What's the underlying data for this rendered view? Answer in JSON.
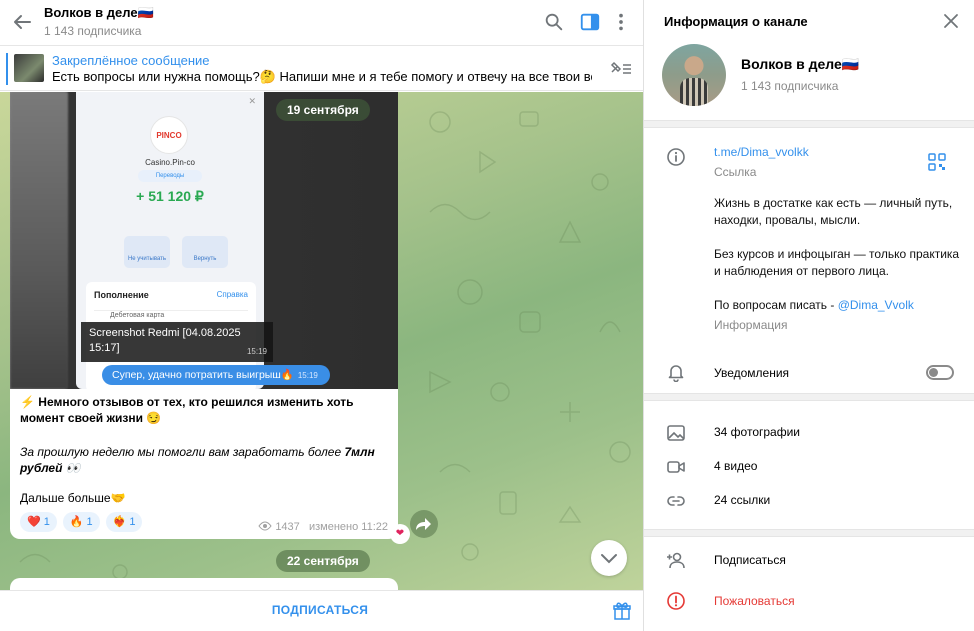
{
  "chat": {
    "title": "Волков в деле🇷🇺",
    "subscribers": "1 143 подписчика",
    "pinned": {
      "title": "Закреплённое сообщение",
      "text": "Есть вопросы или нужна помощь?🤔  Напиши мне и я тебе помогу и отвечу на все твои воп..."
    },
    "dates": [
      "19 сентября",
      "22 сентября"
    ],
    "screenshot": {
      "app_logo": "PINCO",
      "merchant": "Casino.Pin-co",
      "tag": "Переводы",
      "amount": "+ 51 120 ₽",
      "btn_left": "Не учитывать",
      "btn_right": "Вернуть",
      "card_title": "Пополнение",
      "card_link": "Справка",
      "card_sub": "Дебетовая карта",
      "caption": "Screenshot Redmi [04.08.2025 15:17]",
      "caption_time": "15:19",
      "reply_text": "Супер, удачно потратить выигрыш🔥",
      "reply_time": "15:19"
    },
    "message": {
      "p1": "⚡ Немного отзывов от тех, кто решился изменить хоть момент своей жизни 😏",
      "p2_prefix": "За прошлую неделю мы помогли вам заработать более ",
      "p2_bold": "7млн рублей",
      "p2_suffix": " 👀",
      "p3": "Дальше больше🤝",
      "reactions": [
        {
          "emoji": "❤️",
          "count": "1"
        },
        {
          "emoji": "🔥",
          "count": "1"
        },
        {
          "emoji": "❤️‍🔥",
          "count": "1"
        }
      ],
      "views": "1437",
      "edited": "изменено 11:22"
    },
    "subscribe_label": "ПОДПИСАТЬСЯ"
  },
  "info": {
    "title": "Информация о канале",
    "name": "Волков в деле🇷🇺",
    "subscribers": "1 143 подписчика",
    "link": "t.me/Dima_vvolkk",
    "link_caption": "Ссылка",
    "about_p1": "Жизнь в достатке как есть — личный путь, находки, провалы, мысли.",
    "about_p2": "Без курсов и инфоцыган — только практика и наблюдения от первого лица.",
    "about_p3_prefix": "По вопросам писать - ",
    "about_p3_handle": "@Dima_Vvolk",
    "about_caption": "Информация",
    "notifications": "Уведомления",
    "notifications_on": false,
    "media": {
      "photos": "34 фотографии",
      "videos": "4 видео",
      "links": "24 ссылки"
    },
    "subscribe": "Подписаться",
    "report": "Пожаловаться"
  },
  "colors": {
    "accent": "#3390ec",
    "danger": "#e53935",
    "amount_green": "#2aa952"
  },
  "icons": [
    "back-arrow-icon",
    "search-icon",
    "sidebar-toggle-icon",
    "more-vertical-icon",
    "unpin-list-icon",
    "close-icon",
    "info-icon",
    "qr-code-icon",
    "bell-icon",
    "photo-icon",
    "video-icon",
    "link-icon",
    "add-user-icon",
    "report-icon",
    "gift-icon",
    "forward-icon",
    "chevron-down-icon",
    "eye-icon"
  ]
}
